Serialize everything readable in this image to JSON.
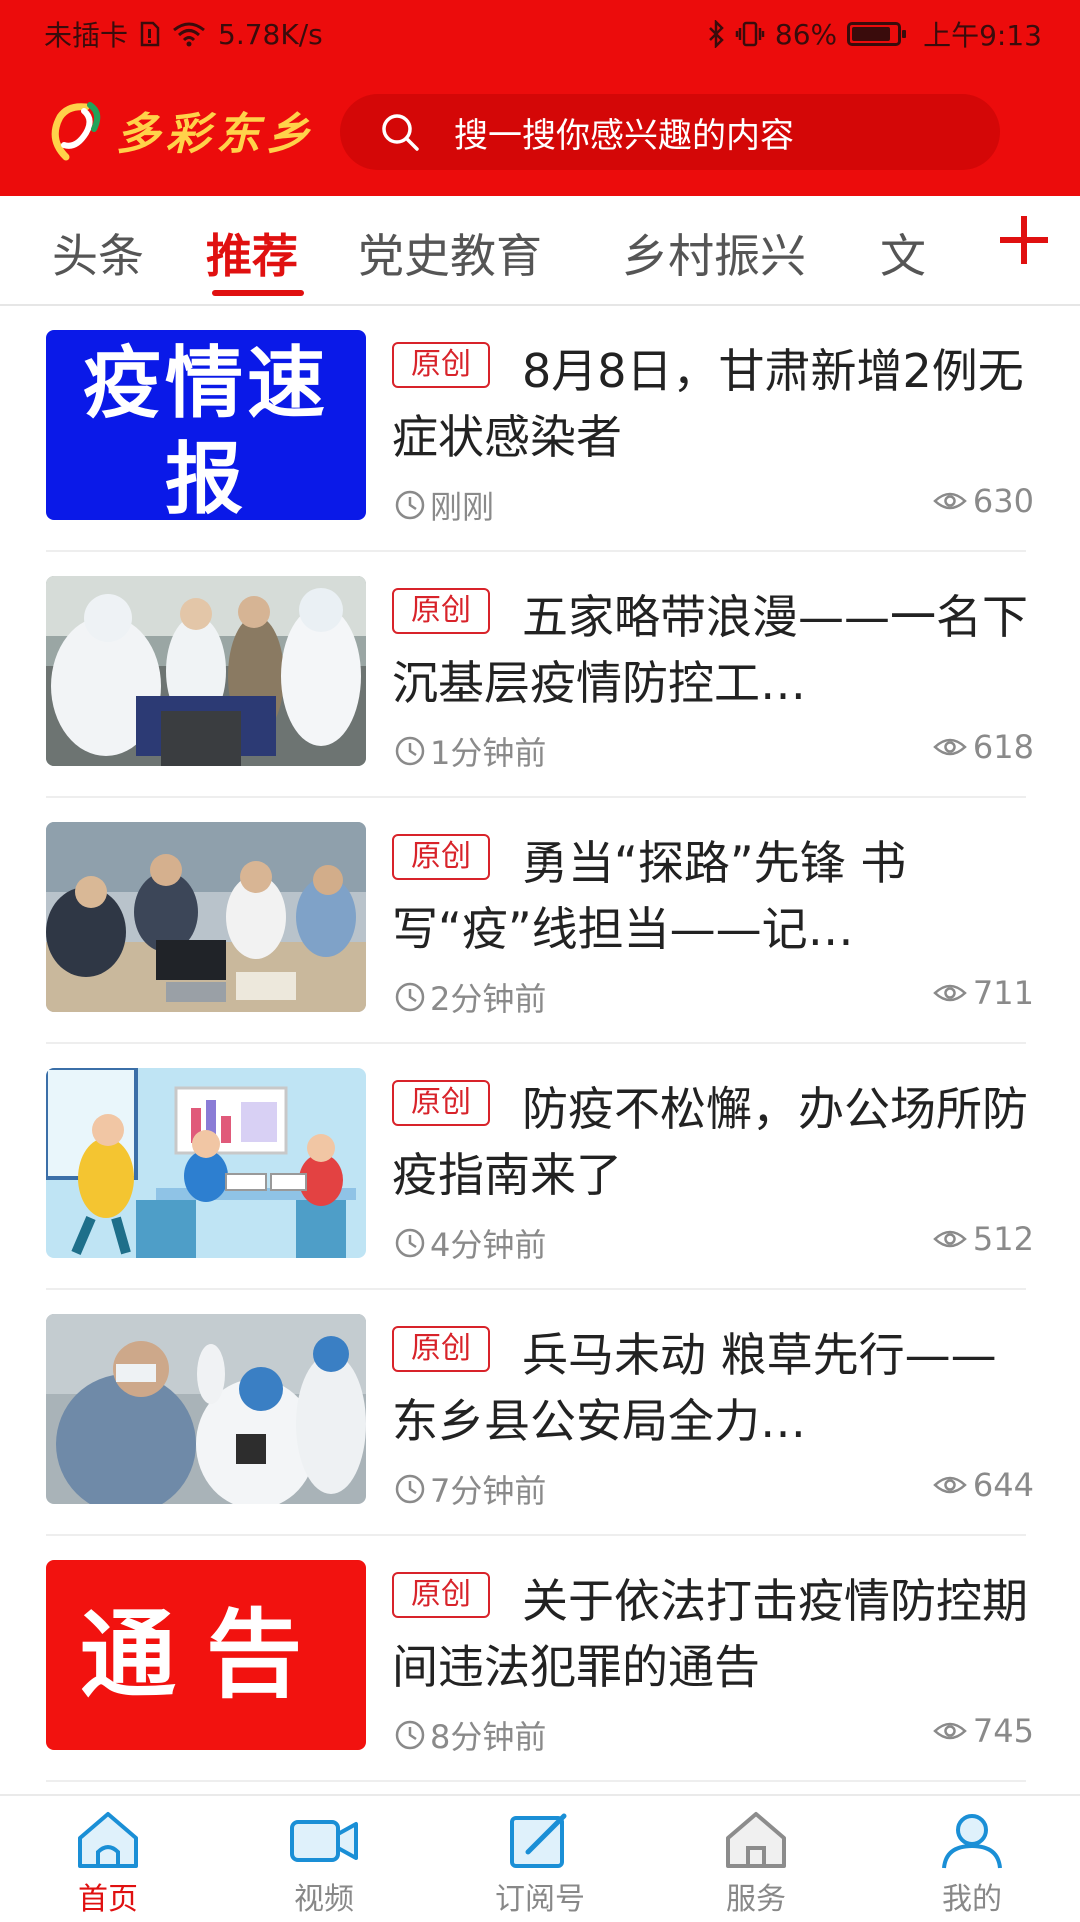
{
  "status_bar": {
    "carrier": "未插卡",
    "speed": "5.78K/s",
    "battery": "86%",
    "battery_level": 0.86,
    "time": "上午9:13"
  },
  "app": {
    "logo_text": "多彩东乡",
    "search_placeholder": "搜一搜你感兴趣的内容",
    "brand_color": "#ec0c0c"
  },
  "tabs": [
    {
      "label": "头条"
    },
    {
      "label": "推荐",
      "active": true
    },
    {
      "label": "党史教育"
    },
    {
      "label": "乡村振兴"
    },
    {
      "label": "文"
    }
  ],
  "news": [
    {
      "tag": "原创",
      "title": "8月8日，甘肃新增2例无症状感染者",
      "time": "刚刚",
      "views": "630",
      "thumb_text": "疫情速报"
    },
    {
      "tag": "原创",
      "title": "五家略带浪漫——一名下沉基层疫情防控工…",
      "time": "1分钟前",
      "views": "618"
    },
    {
      "tag": "原创",
      "title": "勇当“探路”先锋 书写“疫”线担当——记…",
      "time": "2分钟前",
      "views": "711"
    },
    {
      "tag": "原创",
      "title": "防疫不松懈，办公场所防疫指南来了",
      "time": "4分钟前",
      "views": "512"
    },
    {
      "tag": "原创",
      "title": "兵马未动 粮草先行——东乡县公安局全力…",
      "time": "7分钟前",
      "views": "644"
    },
    {
      "tag": "原创",
      "title": "关于依法打击疫情防控期间违法犯罪的通告",
      "time": "8分钟前",
      "views": "745",
      "thumb_text": "通告"
    }
  ],
  "bottom_nav": [
    {
      "label": "首页",
      "icon": "home-icon",
      "active": true
    },
    {
      "label": "视频",
      "icon": "video-icon"
    },
    {
      "label": "订阅号",
      "icon": "subscribe-icon"
    },
    {
      "label": "服务",
      "icon": "service-icon"
    },
    {
      "label": "我的",
      "icon": "user-icon"
    }
  ]
}
